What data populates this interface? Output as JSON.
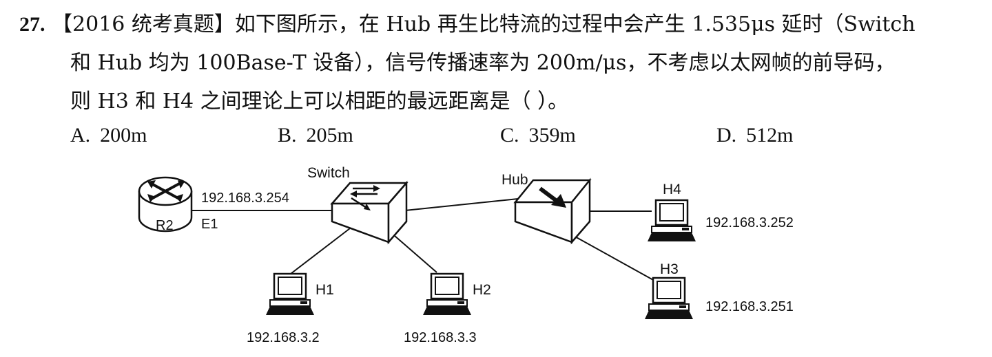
{
  "question": {
    "number": "27.",
    "line1": "【2016 统考真题】如下图所示，在 Hub 再生比特流的过程中会产生 1.535μs 延时（Switch",
    "line2": "和 Hub 均为 100Base-T 设备），信号传播速率为 200m/μs，不考虑以太网帧的前导码，",
    "line3": "则 H3 和 H4 之间理论上可以相距的最远距离是（   ）。"
  },
  "options": [
    {
      "letter": "A.",
      "text": "200m"
    },
    {
      "letter": "B.",
      "text": "205m"
    },
    {
      "letter": "C.",
      "text": "359m"
    },
    {
      "letter": "D.",
      "text": "512m"
    }
  ],
  "diagram": {
    "router": {
      "name": "R2",
      "interface": "E1",
      "ip": "192.168.3.254"
    },
    "switch": {
      "name": "Switch"
    },
    "hub": {
      "name": "Hub"
    },
    "hosts": [
      {
        "name": "H1",
        "ip": "192.168.3.2"
      },
      {
        "name": "H2",
        "ip": "192.168.3.3"
      },
      {
        "name": "H3",
        "ip": "192.168.3.251"
      },
      {
        "name": "H4",
        "ip": "192.168.3.252"
      }
    ]
  }
}
